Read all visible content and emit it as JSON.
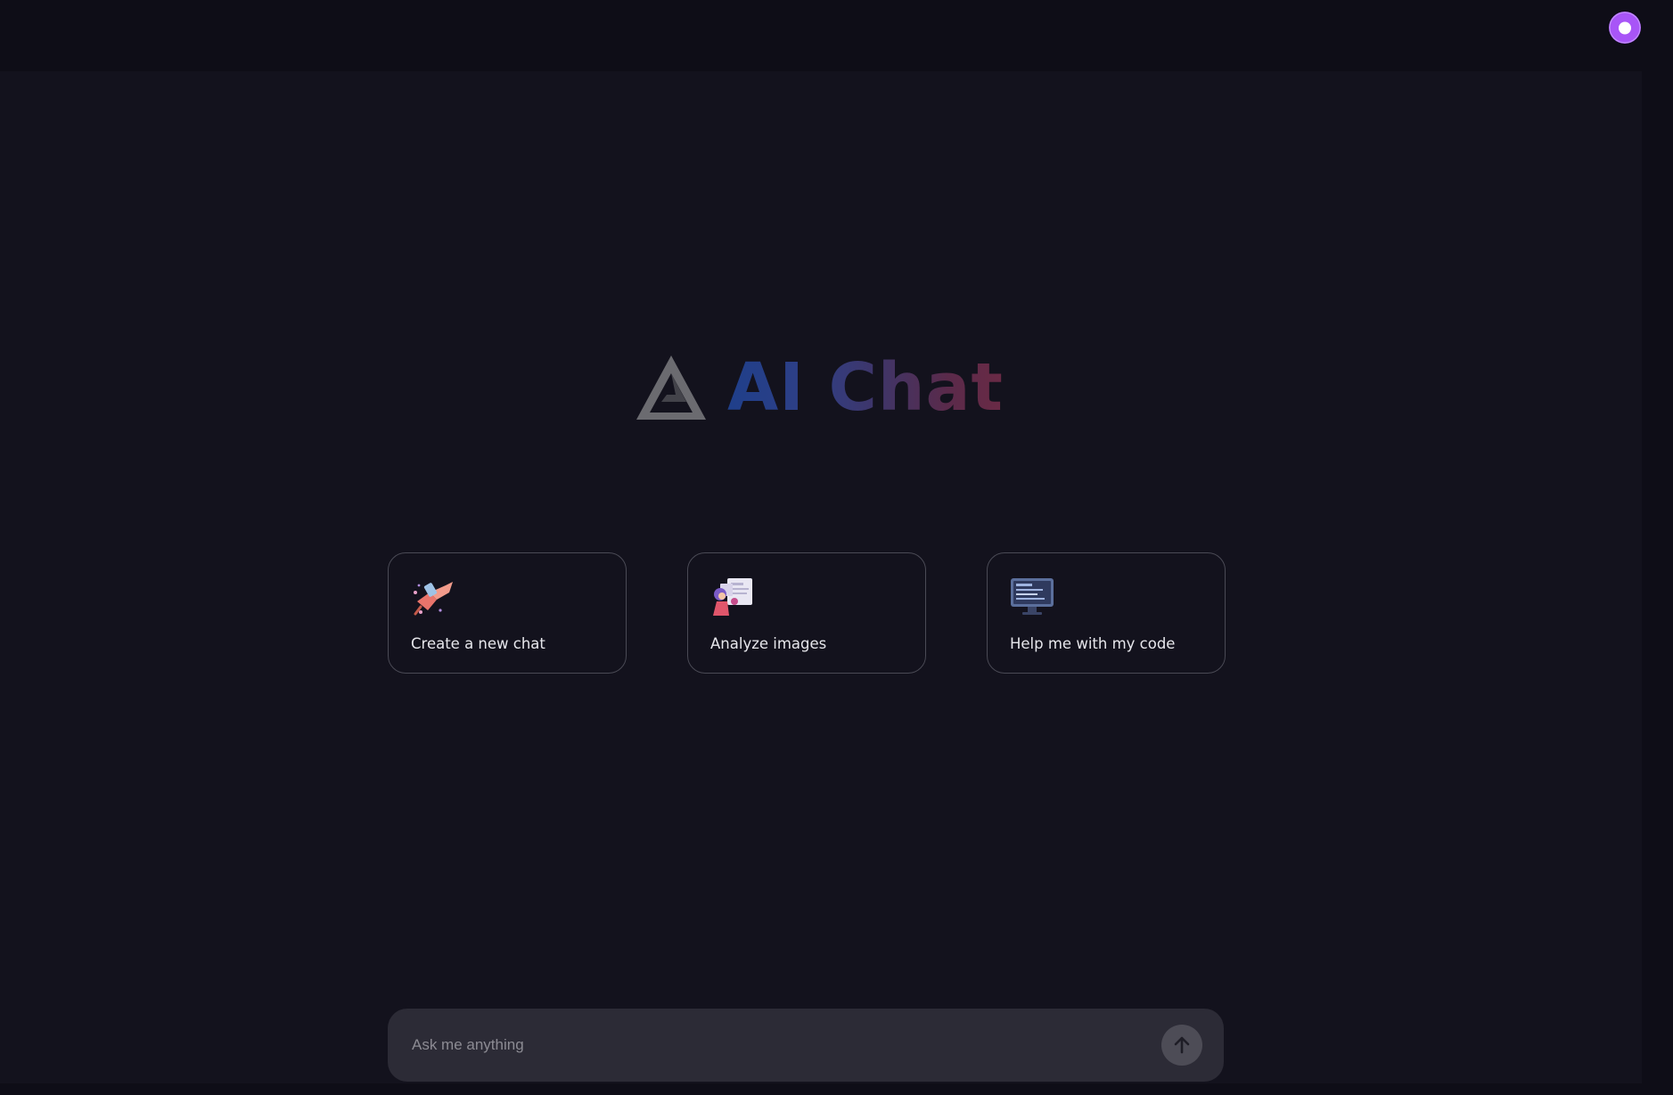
{
  "app": {
    "title": "AI Chat"
  },
  "header": {
    "avatar_icon": "user-avatar-icon"
  },
  "brand": {
    "logo_icon": "triangle-logo-icon",
    "title": "AI Chat"
  },
  "cards": [
    {
      "label": "Create a new chat",
      "icon": "rocket-illustration-icon"
    },
    {
      "label": "Analyze images",
      "icon": "image-analysis-illustration-icon"
    },
    {
      "label": "Help me with my code",
      "icon": "code-monitor-illustration-icon"
    }
  ],
  "composer": {
    "placeholder": "Ask me anything",
    "value": "",
    "send_icon": "arrow-up-icon"
  },
  "colors": {
    "accent_avatar": "#a855f7",
    "background": "#13121d",
    "topbar": "#0e0d17",
    "composer": "#2c2b36"
  }
}
